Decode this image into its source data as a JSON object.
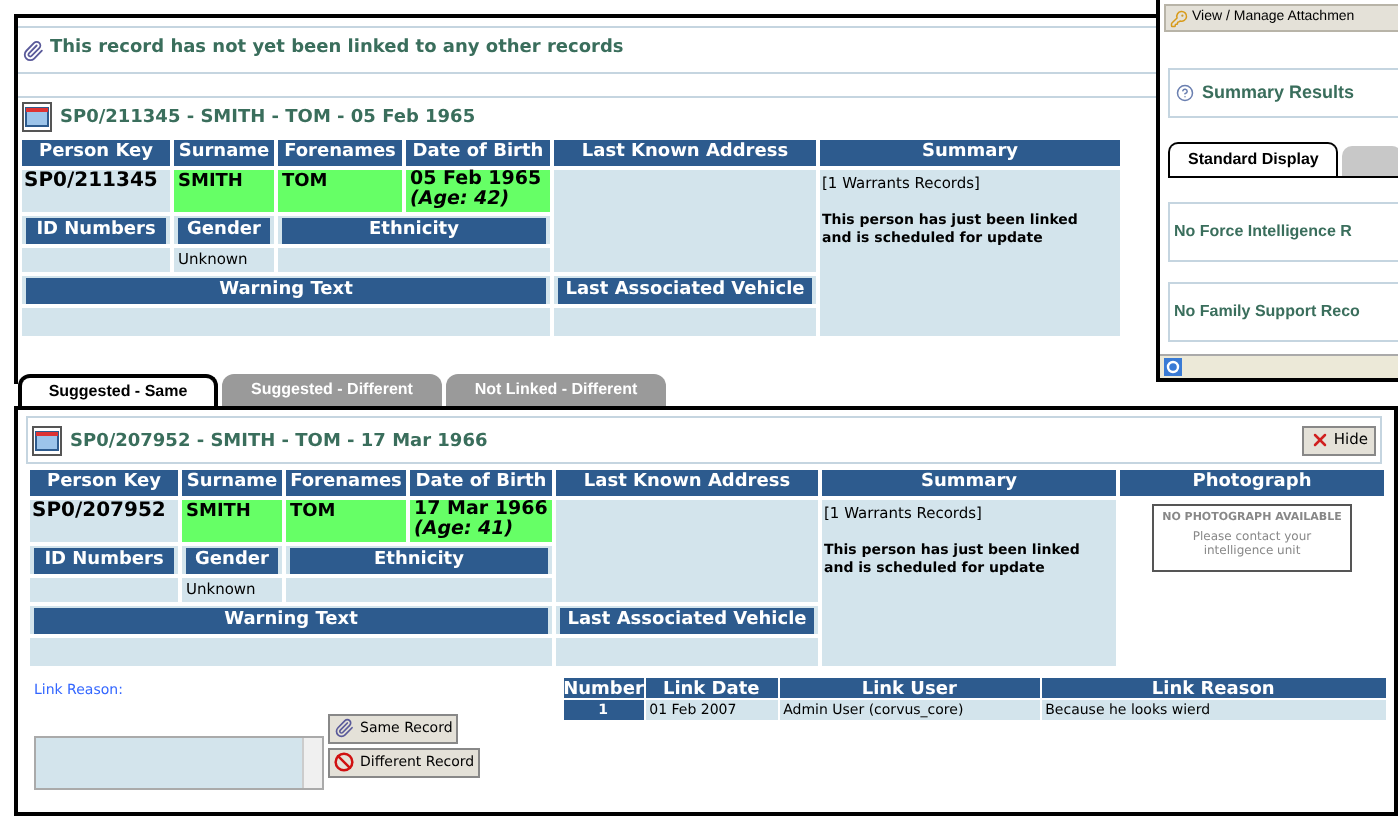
{
  "notice": {
    "text": "This record has not yet been linked to any other records"
  },
  "records": [
    {
      "title": "SP0/211345 - SMITH - TOM - 05 Feb 1965",
      "match_highlight": true,
      "labels": {
        "person_key": "Person Key",
        "surname": "Surname",
        "forenames": "Forenames",
        "date_of_birth": "Date of Birth",
        "last_known_address": "Last Known Address",
        "summary": "Summary",
        "id_numbers": "ID Numbers",
        "gender": "Gender",
        "ethnicity": "Ethnicity",
        "warning_text": "Warning Text",
        "last_associated_vehicle": "Last Associated Vehicle"
      },
      "values": {
        "person_key": "SP0/211345",
        "surname": "SMITH",
        "forenames": "TOM",
        "date_of_birth": "05 Feb 1965",
        "age": "(Age: 42)",
        "gender": "Unknown",
        "summary_records": "[1 Warrants Records]",
        "summary_note": "This person has just been linked and is scheduled for update"
      }
    },
    {
      "title": "SP0/207952 - SMITH - TOM - 17 Mar 1966",
      "hide_button": "Hide",
      "match_highlight": true,
      "labels": {
        "person_key": "Person Key",
        "surname": "Surname",
        "forenames": "Forenames",
        "date_of_birth": "Date of Birth",
        "last_known_address": "Last Known Address",
        "summary": "Summary",
        "id_numbers": "ID Numbers",
        "gender": "Gender",
        "ethnicity": "Ethnicity",
        "warning_text": "Warning Text",
        "last_associated_vehicle": "Last Associated Vehicle",
        "photograph": "Photograph"
      },
      "values": {
        "person_key": "SP0/207952",
        "surname": "SMITH",
        "forenames": "TOM",
        "date_of_birth": "17 Mar 1966",
        "age": "(Age: 41)",
        "gender": "Unknown",
        "summary_records": "[1 Warrants Records]",
        "summary_note": "This person has just been linked and is scheduled for update"
      },
      "photograph": {
        "notice": "NO PHOTOGRAPH AVAILABLE",
        "hint": "Please contact your intelligence unit"
      }
    }
  ],
  "side_panel": {
    "attachments_button": "View / Manage Attachmen",
    "summary_title": "Summary Results",
    "tabs": [
      {
        "label": "Standard Display",
        "selected": true
      }
    ],
    "messages": [
      "No Force Intelligence R",
      "No Family Support Reco"
    ]
  },
  "tabs": [
    {
      "label": "Suggested - Same",
      "selected": true
    },
    {
      "label": "Suggested - Different",
      "selected": false
    },
    {
      "label": "Not Linked - Different",
      "selected": false
    }
  ],
  "link_form": {
    "label": "Link Reason:",
    "buttons": [
      {
        "label": "Same Record",
        "kind": "same"
      },
      {
        "label": "Different Record",
        "kind": "different"
      }
    ]
  },
  "link_table": {
    "columns": [
      "Number",
      "Link Date",
      "Link User",
      "Link Reason"
    ],
    "rows": [
      [
        "1",
        "01 Feb 2007",
        "Admin User (corvus_core)",
        "Because he looks wierd"
      ]
    ]
  }
}
